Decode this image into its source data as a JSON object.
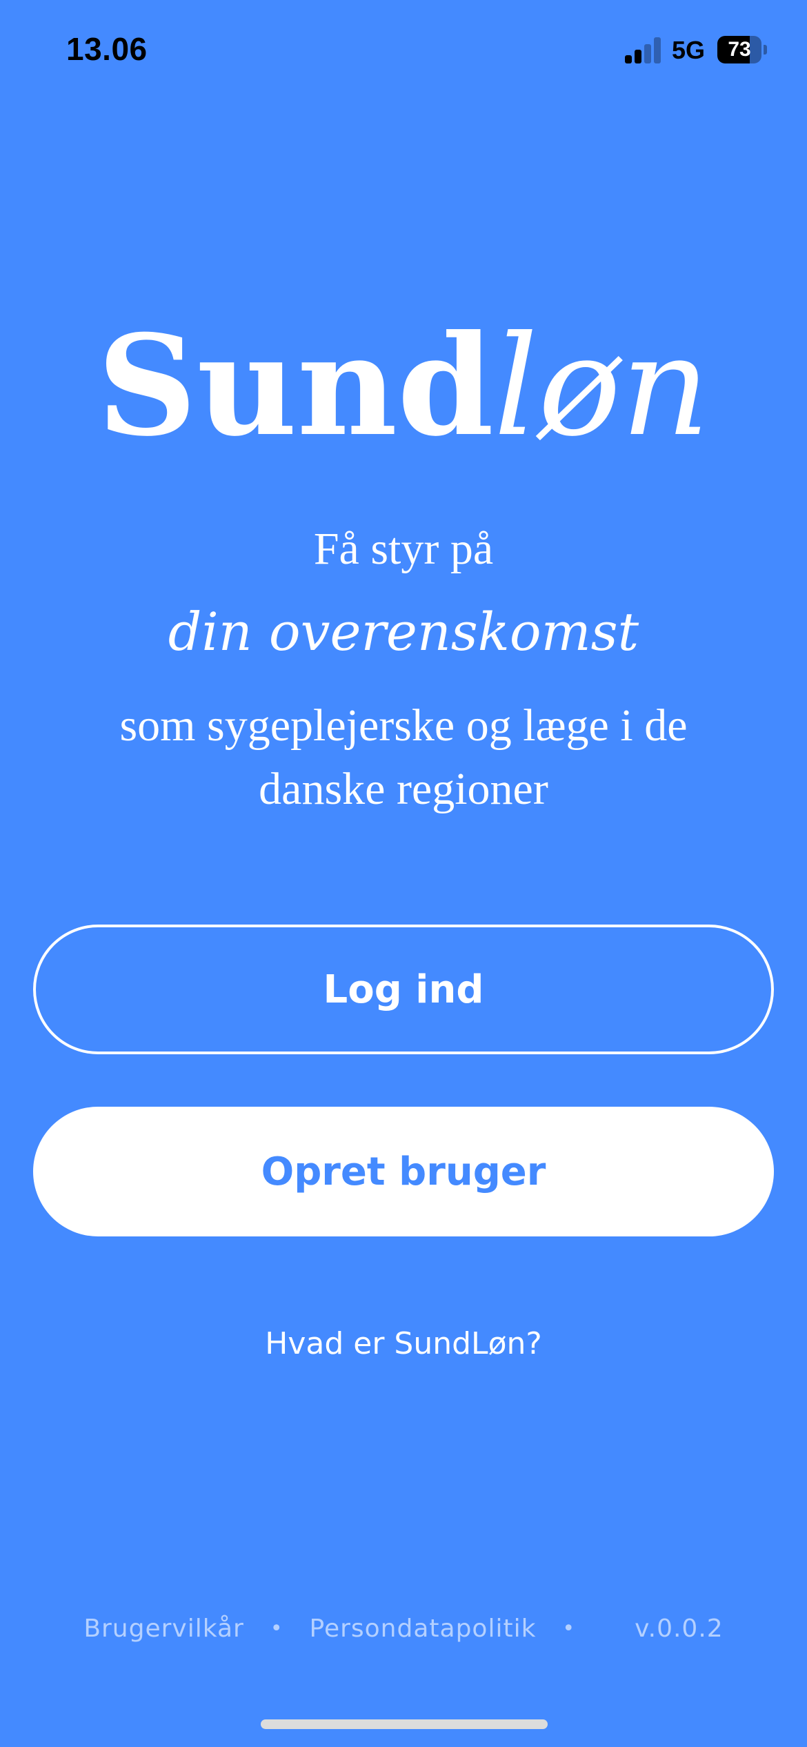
{
  "status_bar": {
    "time": "13.06",
    "network": "5G",
    "battery_percent": "73",
    "battery_level": 0.73,
    "signal_bars_active": 2,
    "signal_bars_total": 4
  },
  "logo": {
    "part1": "Sund",
    "part2": "løn"
  },
  "tagline": {
    "line1": "Få styr på",
    "line2": "din overenskomst",
    "line3": "som sygeplejerske og læge i de danske regioner"
  },
  "buttons": {
    "login_label": "Log ind",
    "signup_label": "Opret bruger"
  },
  "links": {
    "about": "Hvad er SundLøn?"
  },
  "footer": {
    "terms": "Brugervilkår",
    "privacy": "Persondatapolitik",
    "separator": "•",
    "version": "v.0.0.2"
  },
  "colors": {
    "background": "#448aff",
    "text": "#ffffff",
    "signup_text": "#448aff"
  }
}
